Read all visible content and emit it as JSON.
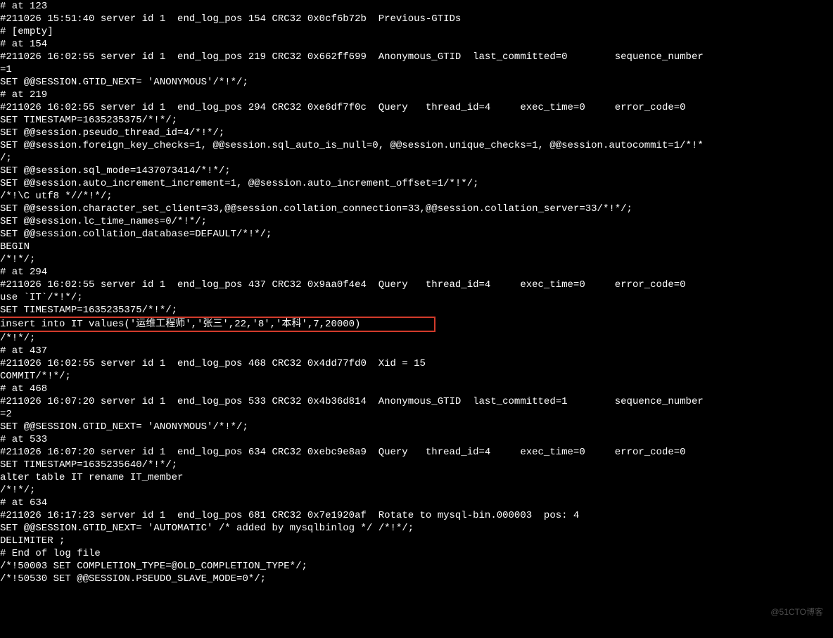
{
  "terminal": {
    "lines": [
      "# at 123",
      "#211026 15:51:40 server id 1  end_log_pos 154 CRC32 0x0cf6b72b  Previous-GTIDs",
      "# [empty]",
      "# at 154",
      "#211026 16:02:55 server id 1  end_log_pos 219 CRC32 0x662ff699  Anonymous_GTID  last_committed=0        sequence_number",
      "=1",
      "SET @@SESSION.GTID_NEXT= 'ANONYMOUS'/*!*/;",
      "# at 219",
      "#211026 16:02:55 server id 1  end_log_pos 294 CRC32 0xe6df7f0c  Query   thread_id=4     exec_time=0     error_code=0",
      "SET TIMESTAMP=1635235375/*!*/;",
      "SET @@session.pseudo_thread_id=4/*!*/;",
      "SET @@session.foreign_key_checks=1, @@session.sql_auto_is_null=0, @@session.unique_checks=1, @@session.autocommit=1/*!*",
      "/;",
      "SET @@session.sql_mode=1437073414/*!*/;",
      "SET @@session.auto_increment_increment=1, @@session.auto_increment_offset=1/*!*/;",
      "/*!\\C utf8 *//*!*/;",
      "SET @@session.character_set_client=33,@@session.collation_connection=33,@@session.collation_server=33/*!*/;",
      "SET @@session.lc_time_names=0/*!*/;",
      "SET @@session.collation_database=DEFAULT/*!*/;",
      "BEGIN",
      "/*!*/;",
      "# at 294",
      "#211026 16:02:55 server id 1  end_log_pos 437 CRC32 0x9aa0f4e4  Query   thread_id=4     exec_time=0     error_code=0",
      "use `IT`/*!*/;",
      "SET TIMESTAMP=1635235375/*!*/;",
      "insert into IT values('运维工程师','张三',22,'8','本科',7,20000)            ",
      "/*!*/;",
      "# at 437",
      "#211026 16:02:55 server id 1  end_log_pos 468 CRC32 0x4dd77fd0  Xid = 15",
      "COMMIT/*!*/;",
      "# at 468",
      "#211026 16:07:20 server id 1  end_log_pos 533 CRC32 0x4b36d814  Anonymous_GTID  last_committed=1        sequence_number",
      "=2",
      "SET @@SESSION.GTID_NEXT= 'ANONYMOUS'/*!*/;",
      "# at 533",
      "#211026 16:07:20 server id 1  end_log_pos 634 CRC32 0xebc9e8a9  Query   thread_id=4     exec_time=0     error_code=0",
      "SET TIMESTAMP=1635235640/*!*/;",
      "alter table IT rename IT_member",
      "/*!*/;",
      "# at 634",
      "#211026 16:17:23 server id 1  end_log_pos 681 CRC32 0x7e1920af  Rotate to mysql-bin.000003  pos: 4",
      "SET @@SESSION.GTID_NEXT= 'AUTOMATIC' /* added by mysqlbinlog */ /*!*/;",
      "DELIMITER ;",
      "# End of log file",
      "/*!50003 SET COMPLETION_TYPE=@OLD_COMPLETION_TYPE*/;",
      "/*!50530 SET @@SESSION.PSEUDO_SLAVE_MODE=0*/;"
    ],
    "highlighted_index": 25
  },
  "watermark": "@51CTO博客"
}
